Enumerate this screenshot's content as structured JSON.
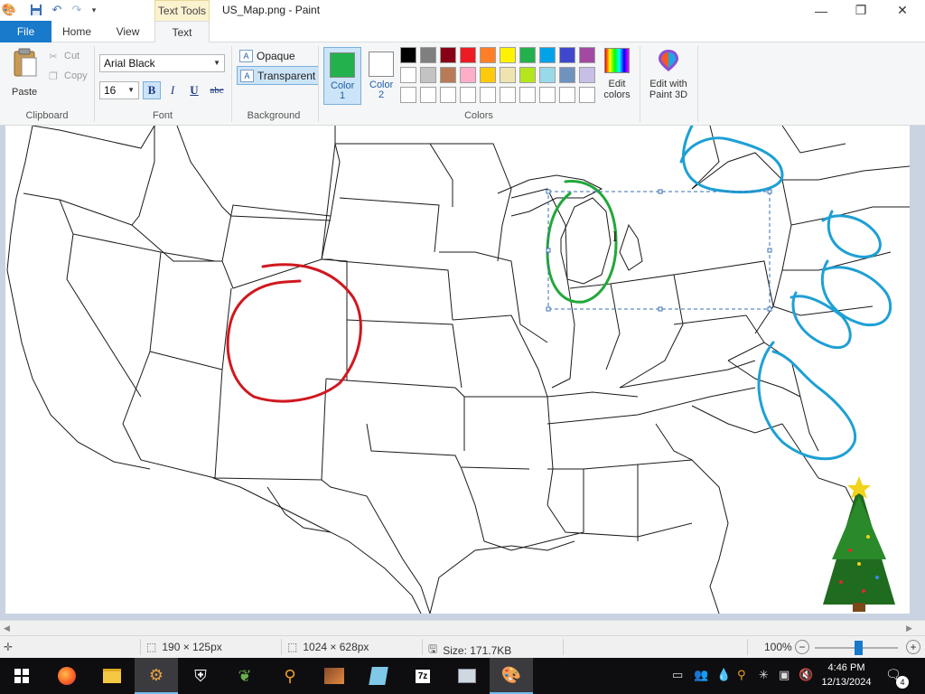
{
  "titlebar": {
    "context_tab": "Text Tools",
    "title": "US_Map.png - Paint",
    "minimize": "—",
    "maximize": "❐",
    "close": "✕"
  },
  "tabs": [
    {
      "label": "File"
    },
    {
      "label": "Home"
    },
    {
      "label": "View"
    },
    {
      "label": "Text"
    }
  ],
  "ribbon": {
    "clipboard": {
      "paste": "Paste",
      "cut": "Cut",
      "copy": "Copy",
      "group": "Clipboard"
    },
    "font": {
      "family": "Arial Black",
      "size": "16",
      "bold": "B",
      "italic": "I",
      "underline": "U",
      "strike": "abc",
      "group": "Font"
    },
    "background": {
      "opaque": "Opaque",
      "transparent": "Transparent",
      "group": "Background"
    },
    "colors": {
      "color1_label": "Color 1",
      "color2_label": "Color 2",
      "color1_value": "#22b14c",
      "color2_value": "#ffffff",
      "group": "Colors",
      "palette_row1": [
        "#000000",
        "#7f7f7f",
        "#880015",
        "#ed1c24",
        "#ff7f27",
        "#fff200",
        "#22b14c",
        "#00a2e8",
        "#3f48cc",
        "#a349a4"
      ],
      "palette_row2": [
        "#ffffff",
        "#c3c3c3",
        "#b97a57",
        "#ffaec9",
        "#ffc90e",
        "#efe4b0",
        "#b5e61d",
        "#99d9ea",
        "#7092be",
        "#c8bfe7"
      ],
      "palette_row3": [
        "#ffffff",
        "#ffffff",
        "#ffffff",
        "#ffffff",
        "#ffffff",
        "#ffffff",
        "#ffffff",
        "#ffffff",
        "#ffffff",
        "#ffffff"
      ]
    },
    "edit_colors": "Edit colors",
    "paint3d": "Edit with Paint 3D"
  },
  "status": {
    "selection_size": "190 × 125px",
    "image_size": "1024 × 628px",
    "file_size": "Size: 171.7KB",
    "zoom": "100%"
  },
  "taskbar": {
    "apps": [
      "start",
      "firefox",
      "file-explorer",
      "app-settings",
      "security",
      "plant-app",
      "search-tool",
      "image-viewer",
      "ebook-app",
      "7zip",
      "network-app",
      "paint"
    ],
    "time": "4:46 PM",
    "date": "12/13/2024",
    "notifications": "4"
  }
}
